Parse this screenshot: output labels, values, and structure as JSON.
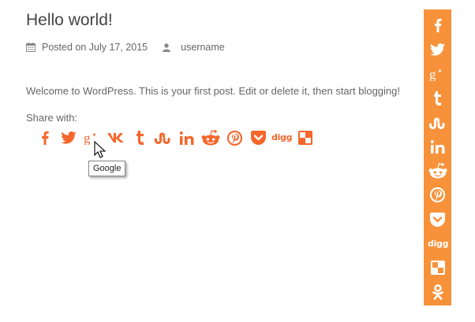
{
  "post": {
    "title": "Hello world!",
    "date": "Posted on July 17, 2015",
    "author": "username",
    "content": "Welcome to WordPress. This is your first post. Edit or delete it, then start blogging!"
  },
  "share": {
    "label": "Share with:",
    "tooltip": "Google",
    "buttons": [
      "facebook-icon",
      "twitter-icon",
      "google-plus-icon",
      "vk-icon",
      "tumblr-icon",
      "stumbleupon-icon",
      "linkedin-icon",
      "reddit-icon",
      "pinterest-icon",
      "pocket-icon",
      "digg-icon",
      "delicious-icon"
    ]
  },
  "floating_bar": {
    "buttons": [
      "facebook-icon",
      "twitter-icon",
      "google-plus-icon",
      "tumblr-icon",
      "stumbleupon-icon",
      "linkedin-icon",
      "reddit-icon",
      "pinterest-icon",
      "pocket-icon",
      "digg-icon",
      "delicious-icon",
      "odnoklassniki-icon"
    ]
  },
  "colors": {
    "accent": "#f7923b",
    "share_icon": "#f5662b",
    "text": "#666666",
    "title": "#444444"
  }
}
